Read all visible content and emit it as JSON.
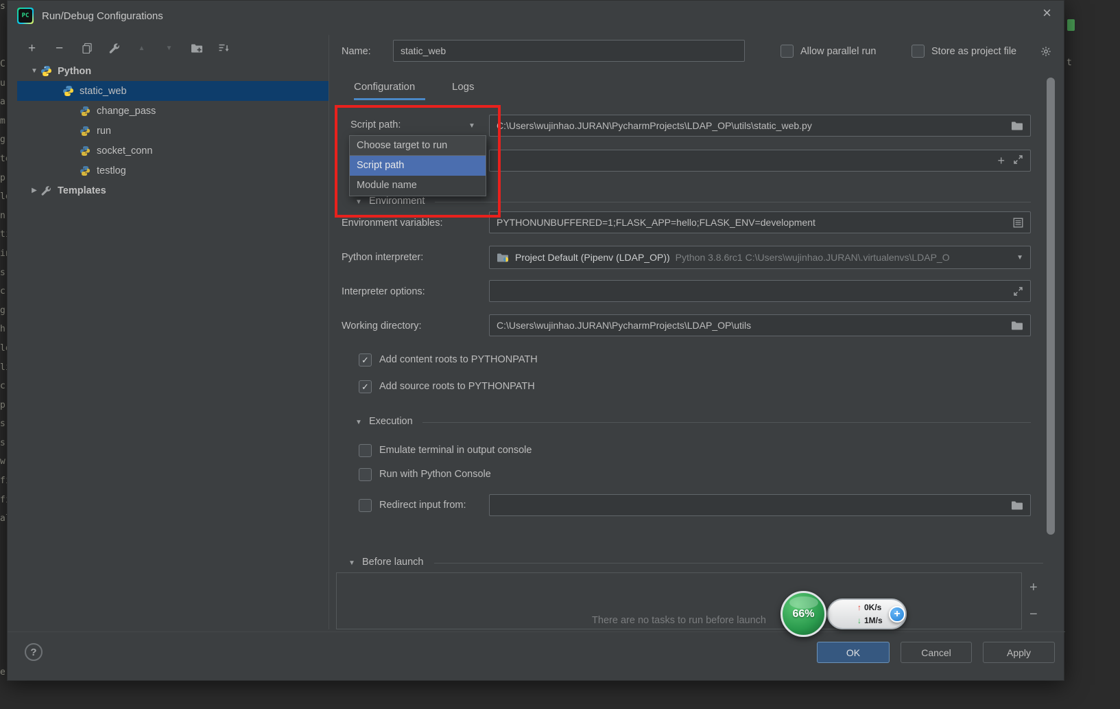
{
  "titlebar": {
    "app_icon": "PC",
    "title": "Run/Debug Configurations",
    "close": "×"
  },
  "toolbar": {
    "add_glyph": "+",
    "remove_glyph": "−",
    "up_glyph": "▲",
    "down_glyph": "▼"
  },
  "glyphs": {
    "collapse": "▼",
    "expand": "▶",
    "combo_arrow": "▼",
    "check": "✓",
    "plus": "+",
    "minus": "−"
  },
  "tree": {
    "root": "Python",
    "items": [
      "static_web",
      "change_pass",
      "run",
      "socket_conn",
      "testlog"
    ],
    "templates": "Templates"
  },
  "header": {
    "name_label": "Name:",
    "name_value": "static_web",
    "allow_parallel": "Allow parallel run",
    "store_as_project": "Store as project file"
  },
  "tabs": {
    "configuration": "Configuration",
    "logs": "Logs"
  },
  "config": {
    "script_path_label": "Script path:",
    "script_path_value": "C:\\Users\\wujinhao.JURAN\\PycharmProjects\\LDAP_OP\\utils\\static_web.py",
    "dropdown": {
      "title": "Choose target to run",
      "option_script": "Script path",
      "option_module": "Module name"
    },
    "environment_section": "Environment",
    "env_label": "Environment variables:",
    "env_value": "PYTHONUNBUFFERED=1;FLASK_APP=hello;FLASK_ENV=development",
    "interpreter_label": "Python interpreter:",
    "interpreter_name": "Project Default (Pipenv (LDAP_OP))",
    "interpreter_path": "Python 3.8.6rc1 C:\\Users\\wujinhao.JURAN\\.virtualenvs\\LDAP_O",
    "interp_opts_label": "Interpreter options:",
    "workdir_label": "Working directory:",
    "workdir_value": "C:\\Users\\wujinhao.JURAN\\PycharmProjects\\LDAP_OP\\utils",
    "add_content_roots": "Add content roots to PYTHONPATH",
    "add_source_roots": "Add source roots to PYTHONPATH",
    "execution_section": "Execution",
    "emulate_terminal": "Emulate terminal in output console",
    "run_python_console": "Run with Python Console",
    "redirect_input": "Redirect input from:"
  },
  "before_launch": {
    "title": "Before launch",
    "empty_text": "There are no tasks to run before launch"
  },
  "footer": {
    "help": "?",
    "ok": "OK",
    "cancel": "Cancel",
    "apply": "Apply"
  },
  "net_overlay": {
    "percent": "66%",
    "up_arrow": "↑",
    "up": "0K/s",
    "down_arrow": "↓",
    "down": "1M/s",
    "plus": "+"
  },
  "edges": {
    "left_top": "s",
    "left_column": "C\nu\na\nm\ng\nte\np\nlo\nn\nti\nin\ns\nc\ng\nh\nlo\nli\nc\np\ns\ns\nw\nfi\nfi\nal",
    "left_bottom": "e",
    "right_fragment": "t"
  },
  "colors": {
    "accent": "#4a88c7",
    "menu_selection": "#4b6eaf",
    "tree_selection": "#0e3d6b",
    "annotation": "#e8211d",
    "ok_bg": "#365880"
  }
}
